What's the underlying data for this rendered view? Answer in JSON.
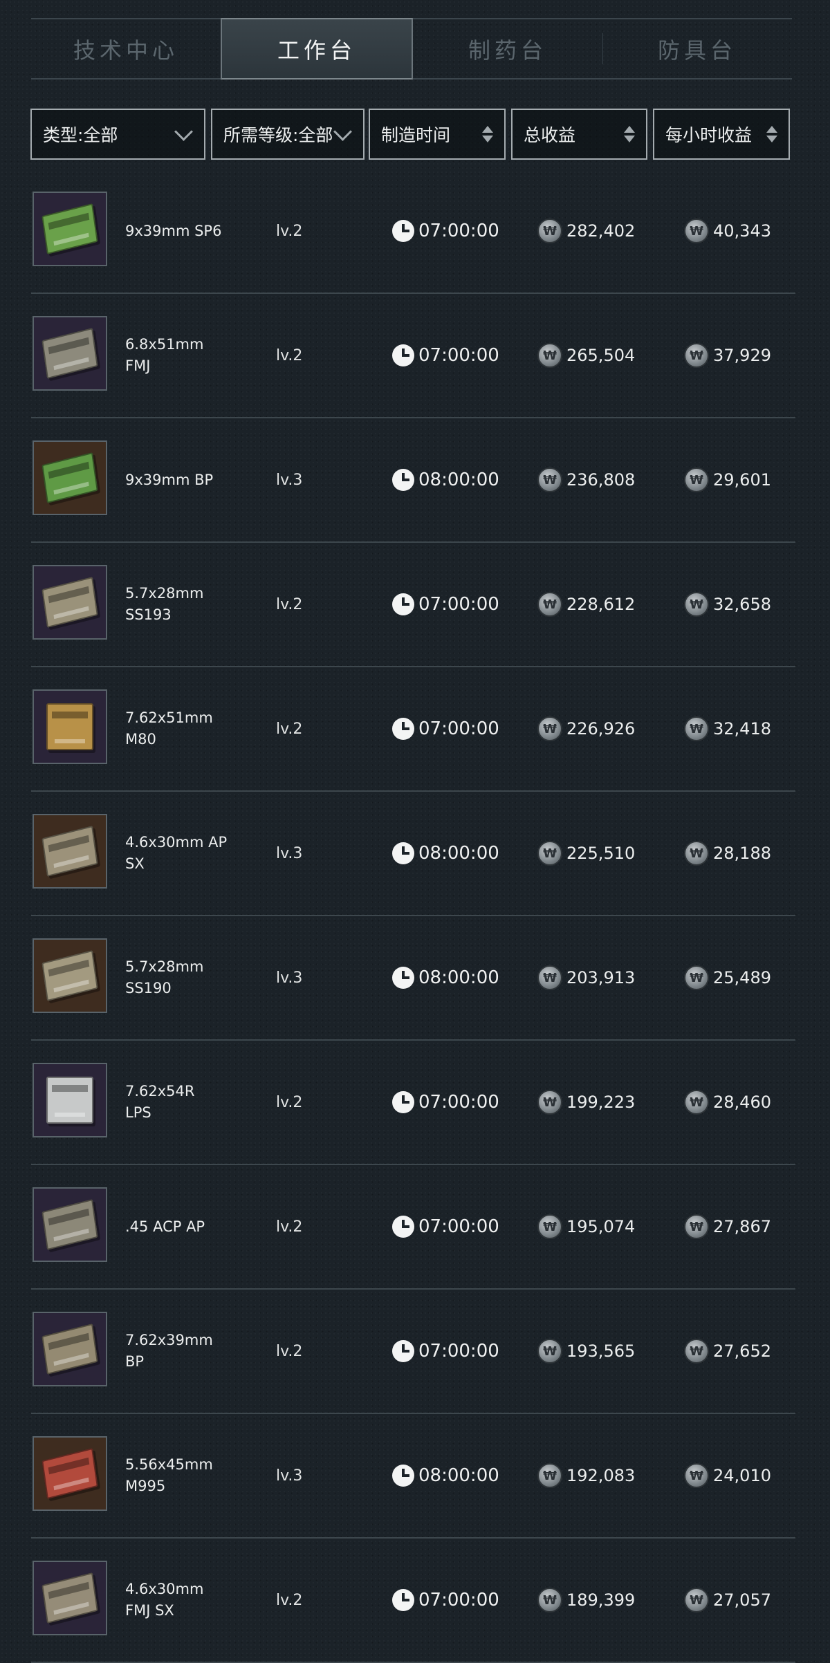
{
  "tabs": [
    {
      "label": "技术中心",
      "active": false
    },
    {
      "label": "工作台",
      "active": true
    },
    {
      "label": "制药台",
      "active": false
    },
    {
      "label": "防具台",
      "active": false
    }
  ],
  "filters": {
    "type": "类型:全部",
    "level": "所需等级:全部",
    "craft_time": "制造时间",
    "total_profit": "总收益",
    "hourly_profit": "每小时收益"
  },
  "rows": [
    {
      "name_line1": "9x39mm SP6",
      "name_line2": "",
      "level": "lv.2",
      "time": "07:00:00",
      "total": "282,402",
      "hourly": "40,343",
      "thumb_bg": "purple",
      "box_color": "#6aa14a"
    },
    {
      "name_line1": "6.8x51mm",
      "name_line2": "FMJ",
      "level": "lv.2",
      "time": "07:00:00",
      "total": "265,504",
      "hourly": "37,929",
      "thumb_bg": "purple",
      "box_color": "#8d8a7c"
    },
    {
      "name_line1": "9x39mm BP",
      "name_line2": "",
      "level": "lv.3",
      "time": "08:00:00",
      "total": "236,808",
      "hourly": "29,601",
      "thumb_bg": "brown",
      "box_color": "#5f9a45"
    },
    {
      "name_line1": "5.7x28mm",
      "name_line2": "SS193",
      "level": "lv.2",
      "time": "07:00:00",
      "total": "228,612",
      "hourly": "32,658",
      "thumb_bg": "purple",
      "box_color": "#9a927a"
    },
    {
      "name_line1": "7.62x51mm",
      "name_line2": "M80",
      "level": "lv.2",
      "time": "07:00:00",
      "total": "226,926",
      "hourly": "32,418",
      "thumb_bg": "purple",
      "box_color": "#b89148"
    },
    {
      "name_line1": "4.6x30mm AP",
      "name_line2": "SX",
      "level": "lv.3",
      "time": "08:00:00",
      "total": "225,510",
      "hourly": "28,188",
      "thumb_bg": "brown",
      "box_color": "#9c927a"
    },
    {
      "name_line1": "5.7x28mm",
      "name_line2": "SS190",
      "level": "lv.3",
      "time": "08:00:00",
      "total": "203,913",
      "hourly": "25,489",
      "thumb_bg": "brown",
      "box_color": "#a39a80"
    },
    {
      "name_line1": "7.62x54R",
      "name_line2": "LPS",
      "level": "lv.2",
      "time": "07:00:00",
      "total": "199,223",
      "hourly": "28,460",
      "thumb_bg": "purple",
      "box_color": "#c7c9c9"
    },
    {
      "name_line1": ".45 ACP AP",
      "name_line2": "",
      "level": "lv.2",
      "time": "07:00:00",
      "total": "195,074",
      "hourly": "27,867",
      "thumb_bg": "purple",
      "box_color": "#8c8878"
    },
    {
      "name_line1": "7.62x39mm",
      "name_line2": "BP",
      "level": "lv.2",
      "time": "07:00:00",
      "total": "193,565",
      "hourly": "27,652",
      "thumb_bg": "purple",
      "box_color": "#948a72"
    },
    {
      "name_line1": "5.56x45mm",
      "name_line2": "M995",
      "level": "lv.3",
      "time": "08:00:00",
      "total": "192,083",
      "hourly": "24,010",
      "thumb_bg": "brown",
      "box_color": "#b24a3c"
    },
    {
      "name_line1": "4.6x30mm",
      "name_line2": "FMJ SX",
      "level": "lv.2",
      "time": "07:00:00",
      "total": "189,399",
      "hourly": "27,057",
      "thumb_bg": "purple",
      "box_color": "#958c78"
    }
  ]
}
